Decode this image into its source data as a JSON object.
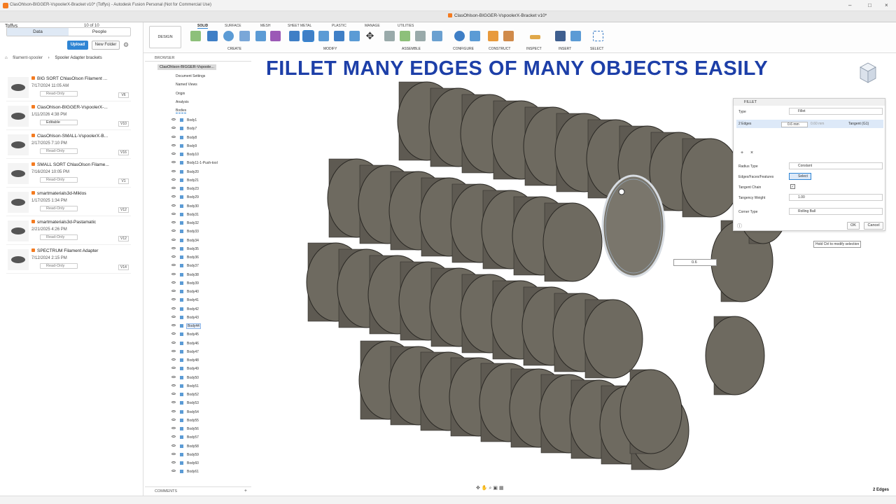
{
  "window": {
    "title": "ClasOhlson-BIGGER-VspoolerX-Bracket v10* (Toffys) - Autodesk Fusion Personal (Not for Commercial Use)",
    "doc_tab": "ClasOhlson-BIGGER-VspoolerX-Bracket v10*"
  },
  "data_panel": {
    "team": "Toffys",
    "counter": "10 of 10",
    "tabs": [
      "Data",
      "People"
    ],
    "upload_label": "Upload",
    "new_folder_label": "New Folder",
    "breadcrumb": [
      "filament-spooler",
      "Spooler Adapter brackets"
    ],
    "files": [
      {
        "name": "BIG SORT ChlasOlson Filament ...",
        "date": "7/17/2024 11:05 AM",
        "status": "Read-Only",
        "version": "V6"
      },
      {
        "name": "ClasOhlson-BIGGER-VspoolerX-...",
        "date": "1/11/2026 4:38 PM",
        "status": "Editable",
        "version": "V10"
      },
      {
        "name": "ClasOhlson-SMALL-VspoolerX-B...",
        "date": "2/17/2025 7:10 PM",
        "status": "Read-Only",
        "version": "V16"
      },
      {
        "name": "SMALL SORT ChlasOlson Filame...",
        "date": "7/16/2024 10:05 PM",
        "status": "Read-Only",
        "version": "V1"
      },
      {
        "name": "smartmaterials3d-Miklos",
        "date": "1/17/2025 1:34 PM",
        "status": "Read-Only",
        "version": "V12"
      },
      {
        "name": "smartmaterials3d-Pastamatic",
        "date": "2/21/2025 4:26 PM",
        "status": "Read-Only",
        "version": "V12"
      },
      {
        "name": "SPECTRUM Filament Adapter",
        "date": "7/12/2024 2:15 PM",
        "status": "Read-Only",
        "version": "V14"
      }
    ]
  },
  "toolbar": {
    "workspace": "DESIGN",
    "tabs": [
      "SOLID",
      "SURFACE",
      "MESH",
      "SHEET METAL",
      "PLASTIC",
      "MANAGE",
      "UTILITIES"
    ],
    "groups": [
      "CREATE",
      "MODIFY",
      "ASSEMBLE",
      "CONFIGURE",
      "CONSTRUCT",
      "INSPECT",
      "INSERT",
      "SELECT"
    ]
  },
  "browser": {
    "header": "BROWSER",
    "root": "ClasOhlson-BIGGER-Vspoole...",
    "folders": [
      "Document Settings",
      "Named Views",
      "Origin",
      "Analysis",
      "Bodies"
    ],
    "bodies": [
      "Body1",
      "Body7",
      "Body8",
      "Body9",
      "Body10",
      "Body11-1-Push-tool",
      "Body20",
      "Body21",
      "Body23",
      "Body29",
      "Body30",
      "Body31",
      "Body32",
      "Body33",
      "Body34",
      "Body35",
      "Body36",
      "Body37",
      "Body38",
      "Body39",
      "Body40",
      "Body41",
      "Body42",
      "Body43",
      "Body44",
      "Body45",
      "Body46",
      "Body47",
      "Body48",
      "Body49",
      "Body50",
      "Body51",
      "Body52",
      "Body53",
      "Body54",
      "Body55",
      "Body56",
      "Body57",
      "Body58",
      "Body59",
      "Body60",
      "Body61"
    ],
    "selected_body": "Body44",
    "comments": "COMMENTS"
  },
  "viewport": {
    "headline": "FILLET MANY EDGES OF MANY OBJECTS EASILY",
    "dimension_value": "0.6",
    "hint": "Hold Ctrl to modify selection",
    "selection_count": "2 Edges"
  },
  "fillet": {
    "title": "FILLET",
    "type_label": "Type",
    "type_value": "Fillet",
    "edges_label": "2 Edges",
    "radius_value": "0.6 mm",
    "radius_alt": "0.60 mm",
    "tangent_value": "Tangent (G1)",
    "radius_type_label": "Radius Type",
    "radius_type_value": "Constant",
    "edges_features_label": "Edges/Faces/Features",
    "select_label": "Select",
    "tangent_chain_label": "Tangent Chain",
    "tangency_weight_label": "Tangency Weight",
    "tangency_weight_value": "1.00",
    "corner_type_label": "Corner Type",
    "corner_type_value": "Rolling Ball",
    "ok_label": "OK",
    "cancel_label": "Cancel"
  },
  "colors": {
    "accent": "#2f85d4",
    "headline": "#1d3fa8",
    "body": "#6e6a60"
  }
}
